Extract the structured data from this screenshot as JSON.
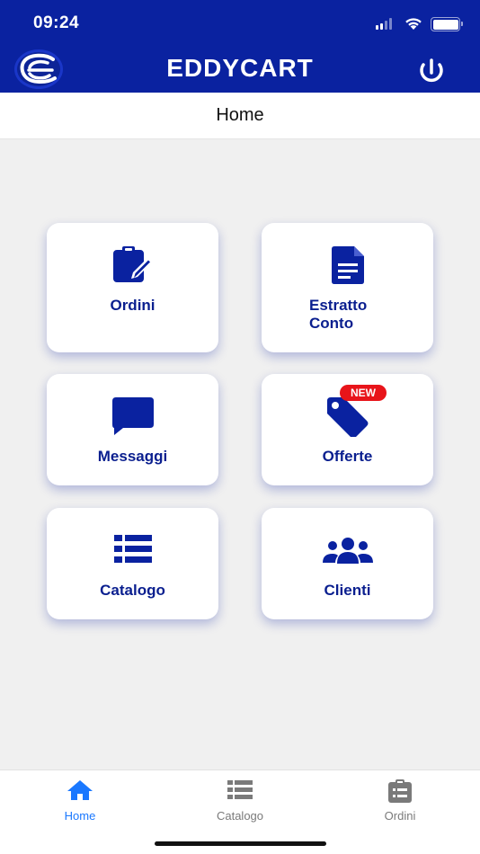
{
  "status": {
    "time": "09:24",
    "signal_bars": 2,
    "battery_level": 1.0
  },
  "navbar": {
    "title": "EDDYCART",
    "logo_icon": "eddycart-logo-icon",
    "power_icon": "power-icon"
  },
  "subheader": {
    "title": "Home"
  },
  "tiles": [
    {
      "id": "ordini",
      "line1": "Ordini",
      "line2": "",
      "icon": "clipboard-edit-icon"
    },
    {
      "id": "estratto-conto",
      "line1": "Estratto",
      "line2": "Conto",
      "icon": "document-icon"
    },
    {
      "id": "messaggi",
      "line1": "Messaggi",
      "line2": "",
      "icon": "chat-bubble-icon"
    },
    {
      "id": "offerte",
      "line1": "Offerte",
      "line2": "",
      "icon": "tag-icon",
      "badge": "NEW"
    },
    {
      "id": "catalogo",
      "line1": "Catalogo",
      "line2": "",
      "icon": "list-icon"
    },
    {
      "id": "clienti",
      "line1": "Clienti",
      "line2": "",
      "icon": "users-icon"
    }
  ],
  "tabbar": {
    "tabs": [
      {
        "label": "Home",
        "icon": "home-icon",
        "active": true
      },
      {
        "label": "Catalogo",
        "icon": "list-icon",
        "active": false
      },
      {
        "label": "Ordini",
        "icon": "clipboard-list-icon",
        "active": false
      }
    ]
  },
  "colors": {
    "primary": "#0a22a0",
    "tile_text": "#0a1f8f",
    "badge": "#e8141a",
    "tab_active": "#1a78ff",
    "tab_inactive": "#7a7a7a",
    "background": "#f0f0f0"
  }
}
